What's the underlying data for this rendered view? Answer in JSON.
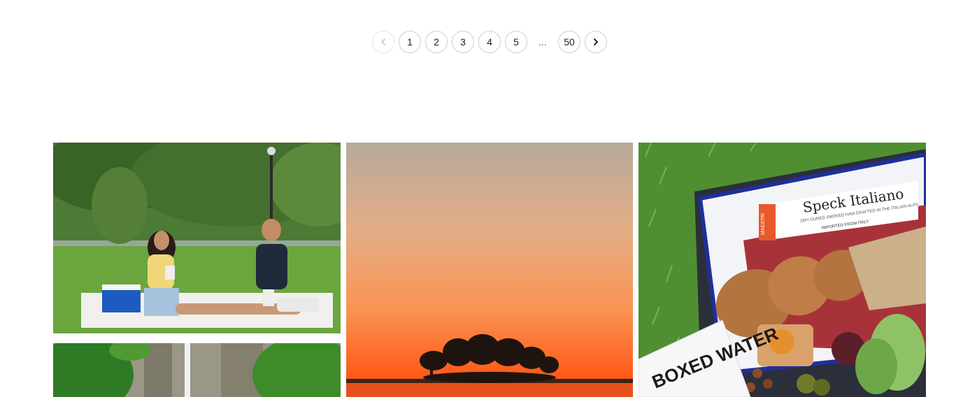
{
  "pagination": {
    "prev_icon": "chevron-left-icon",
    "pages": [
      "1",
      "2",
      "3",
      "4",
      "5"
    ],
    "ellipsis": "...",
    "last_page": "50",
    "next_icon": "chevron-right-icon"
  },
  "gallery": {
    "photos": [
      {
        "name": "picnic couple in park",
        "carton_text": "BOXED WATER"
      },
      {
        "name": "waterfall between green trees"
      },
      {
        "name": "sunset over lake with tree island"
      },
      {
        "name": "picnic basket with speck and bread",
        "package_title": "Speck Italiano",
        "package_subtitle": "DRY CURED SMOKED HAM CRAFTED IN THE ITALIAN ALPS",
        "package_origin": "IMPORTED FROM ITALY",
        "brand": "MAESTRI",
        "carton_text": "BOXED WATER"
      }
    ]
  },
  "colors": {
    "sunset_top": "#b8aa9a",
    "sunset_mid": "#f6a169",
    "sunset_low": "#ff6a22",
    "grass": "#5b9a3a",
    "accent_blue": "#1f2f9a"
  }
}
